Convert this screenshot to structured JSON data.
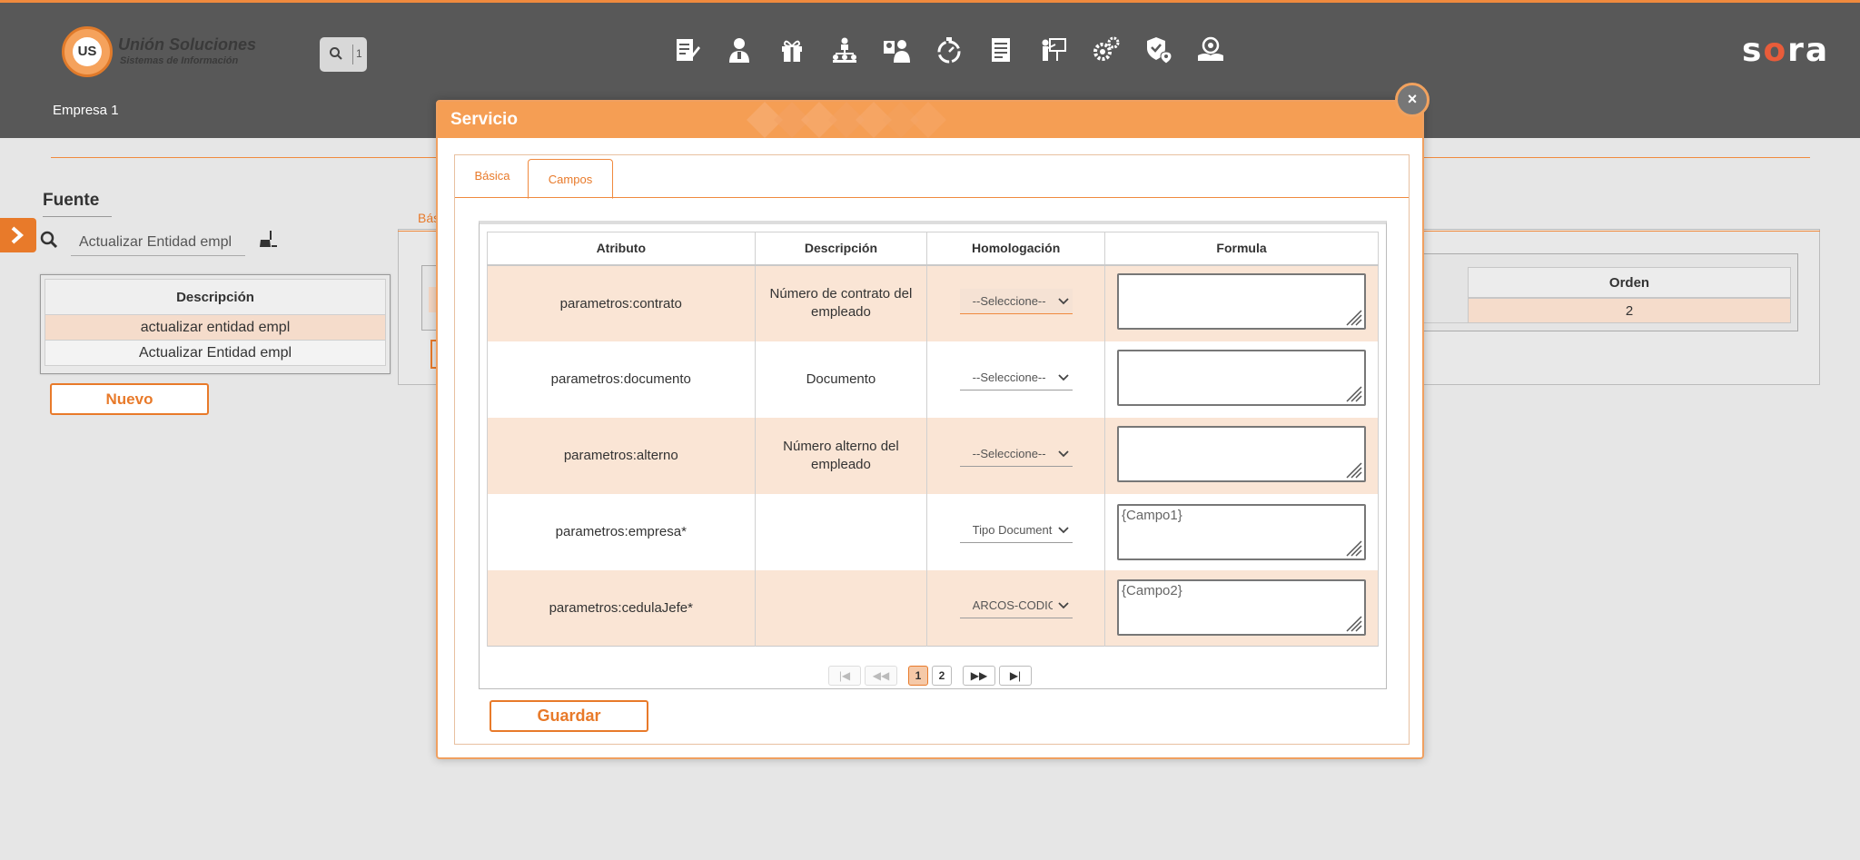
{
  "header": {
    "logo_badge": "US",
    "logo_title": "Unión Soluciones",
    "logo_subtitle": "Sistemas de Información",
    "search_value": "1",
    "brand": {
      "pre": "s",
      "accent": "o",
      "post": "ra"
    },
    "company": "Empresa 1",
    "nav_icons": [
      "document-edit-icon",
      "user-icon",
      "gift-icon",
      "org-chart-icon",
      "users-icon",
      "stopwatch-icon",
      "list-document-icon",
      "presentation-icon",
      "gears-icon",
      "shield-location-icon",
      "hand-eye-icon"
    ]
  },
  "left_panel": {
    "title": "Fuente",
    "search_value": "Actualizar Entidad empl",
    "table": {
      "header": "Descripción",
      "rows": [
        "actualizar entidad empl",
        "Actualizar Entidad empl"
      ]
    },
    "new_button": "Nuevo"
  },
  "background_panel": {
    "tab_label": "Bás",
    "orden_header": "Orden",
    "orden_value": "2"
  },
  "modal": {
    "title": "Servicio",
    "close_label": "×",
    "tabs": [
      {
        "label": "Básica",
        "active": false
      },
      {
        "label": "Campos",
        "active": true
      }
    ],
    "columns": [
      "Atributo",
      "Descripción",
      "Homologación",
      "Formula"
    ],
    "rows": [
      {
        "atributo": "parametros:contrato",
        "descripcion": "Número de contrato del empleado",
        "homologacion": "--Seleccione--",
        "formula": ""
      },
      {
        "atributo": "parametros:documento",
        "descripcion": "Documento",
        "homologacion": "--Seleccione--",
        "formula": ""
      },
      {
        "atributo": "parametros:alterno",
        "descripcion": "Número alterno del empleado",
        "homologacion": "--Seleccione--",
        "formula": ""
      },
      {
        "atributo": "parametros:empresa*",
        "descripcion": "",
        "homologacion": "Tipo Documento",
        "formula": "{Campo1}"
      },
      {
        "atributo": "parametros:cedulaJefe*",
        "descripcion": "",
        "homologacion": "ARCOS-CODIGO",
        "formula": "{Campo2}"
      }
    ],
    "pager": {
      "first": "|◀",
      "prev": "◀◀",
      "pages": [
        "1",
        "2"
      ],
      "current_page": "1",
      "next": "▶▶",
      "last": "▶|"
    },
    "save_button": "Guardar"
  },
  "colors": {
    "accent": "#e87a2a",
    "header_bg": "#585858",
    "row_highlight": "#fae5d5"
  }
}
